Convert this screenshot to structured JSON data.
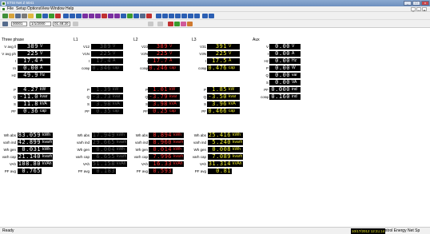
{
  "window": {
    "title": "ETSI Net Z 5041",
    "min": "_",
    "max": "□",
    "close": "x"
  },
  "menu": [
    "File",
    "Setup",
    "Options",
    "View",
    "Window",
    "Help"
  ],
  "mdi": {
    "min": "_",
    "restore": "▫",
    "close": "x"
  },
  "toolbar2": {
    "device": "00001",
    "date": "1/1/2000",
    "time": "01:48:20"
  },
  "sections": {
    "three": "Three phase",
    "l1": "L1",
    "l2": "L2",
    "l3": "L3",
    "aux": "Aux"
  },
  "three_phase": [
    {
      "label": "V avg ll",
      "value": "389",
      "unit": "V"
    },
    {
      "label": "V avg ph",
      "value": "225",
      "unit": "V"
    },
    {
      "label": "I",
      "value": "17.4",
      "unit": "A"
    },
    {
      "label": "In",
      "value": "0.00",
      "unit": "A"
    },
    {
      "label": "Hz",
      "value": "49.9",
      "unit": "Hz"
    },
    {
      "label": "P",
      "value": "4.27",
      "unit": "kW"
    },
    {
      "label": "Q",
      "value": "-11.0",
      "unit": "kvar"
    },
    {
      "label": "S",
      "value": "11.8",
      "unit": "kVA"
    },
    {
      "label": "PF",
      "value": "0.36",
      "unit": "cap"
    }
  ],
  "l1": [
    {
      "label": "V12",
      "value": "389",
      "unit": "V"
    },
    {
      "label": "V1N",
      "value": "225",
      "unit": "V"
    },
    {
      "label": "I",
      "value": "17.4",
      "unit": "A"
    },
    {
      "label": "cosφ",
      "value": "0.346",
      "unit": "cap"
    },
    {
      "label": "P",
      "value": "1.39",
      "unit": "kW"
    },
    {
      "label": "Q",
      "value": "-3.73",
      "unit": "kvar"
    },
    {
      "label": "S",
      "value": "3.98",
      "unit": "kVA"
    },
    {
      "label": "PF",
      "value": "0.35",
      "unit": "cap"
    }
  ],
  "l2": [
    {
      "label": "V23",
      "value": "389",
      "unit": "V"
    },
    {
      "label": "V2N",
      "value": "225",
      "unit": "V"
    },
    {
      "label": "I",
      "value": "17.7",
      "unit": "A"
    },
    {
      "label": "cosφ",
      "value": "0.246",
      "unit": "cap"
    },
    {
      "label": "P",
      "value": "1.01",
      "unit": "kW"
    },
    {
      "label": "Q",
      "value": "-3.79",
      "unit": "kvar"
    },
    {
      "label": "S",
      "value": "3.98",
      "unit": "kVA"
    },
    {
      "label": "PF",
      "value": "0.25",
      "unit": "cap"
    }
  ],
  "l3": [
    {
      "label": "V31",
      "value": "391",
      "unit": "V"
    },
    {
      "label": "V3N",
      "value": "225",
      "unit": "V"
    },
    {
      "label": "I",
      "value": "17.5",
      "unit": "A"
    },
    {
      "label": "cosφ",
      "value": "0.476",
      "unit": "cap"
    },
    {
      "label": "P",
      "value": "1.85",
      "unit": "kW"
    },
    {
      "label": "Q",
      "value": "-3.50",
      "unit": "kvar"
    },
    {
      "label": "S",
      "value": "3.96",
      "unit": "kVA"
    },
    {
      "label": "PF",
      "value": "0.466",
      "unit": "cap"
    }
  ],
  "aux": [
    {
      "label": "V",
      "value": "0.00",
      "unit": "V"
    },
    {
      "label": "I",
      "value": "0.00",
      "unit": "A"
    },
    {
      "label": "Hz",
      "value": "0.00",
      "unit": "Hz"
    },
    {
      "label": "P",
      "value": "0.00",
      "unit": "W"
    },
    {
      "label": "Q",
      "value": "0.00",
      "unit": "var"
    },
    {
      "label": "S",
      "value": "0.00",
      "unit": "VA"
    },
    {
      "label": "PF",
      "value": "0.000",
      "unit": "ind"
    },
    {
      "label": "cosφ",
      "value": "0.160",
      "unit": "ind"
    }
  ],
  "energy_three": [
    {
      "label": "Wh abs",
      "value": "83.059",
      "unit": "kWh"
    },
    {
      "label": "varh ind",
      "value": "42.899",
      "unit": "kvarh"
    },
    {
      "label": "Wh gen",
      "value": "0.031",
      "unit": "kWh"
    },
    {
      "label": "varh cap",
      "value": "21.140",
      "unit": "kvarh"
    },
    {
      "label": "VAh",
      "value": "108.80",
      "unit": "kVAh"
    },
    {
      "label": "PF avg",
      "value": "0.765",
      "unit": ""
    }
  ],
  "energy_l1": [
    {
      "label": "Wh abs",
      "value": "17.949",
      "unit": "kWh"
    },
    {
      "label": "varh ind",
      "value": "29.665",
      "unit": "kvarh"
    },
    {
      "label": "Wh gen",
      "value": "0.004",
      "unit": "kWh"
    },
    {
      "label": "varh cap",
      "value": "6.655",
      "unit": "kvarh"
    },
    {
      "label": "VAh",
      "value": "51.158",
      "unit": "kVAh"
    },
    {
      "label": "PF avg",
      "value": "0.183",
      "unit": ""
    }
  ],
  "energy_l2": [
    {
      "label": "Wh abs",
      "value": "8.894",
      "unit": "kWh"
    },
    {
      "label": "varh ind",
      "value": "8.960",
      "unit": "kvarh"
    },
    {
      "label": "Wh gen",
      "value": "0.014",
      "unit": "kWh"
    },
    {
      "label": "varh cap",
      "value": "7.996",
      "unit": "kvarh"
    },
    {
      "label": "VAh",
      "value": "16.33",
      "unit": "kVAh"
    },
    {
      "label": "PF avg",
      "value": "0.593",
      "unit": ""
    }
  ],
  "energy_l3": [
    {
      "label": "Wh abs",
      "value": "25.416",
      "unit": "kWh"
    },
    {
      "label": "varh ind",
      "value": "5.240",
      "unit": "kvarh"
    },
    {
      "label": "Wh gen",
      "value": "0.008",
      "unit": "kWh"
    },
    {
      "label": "varh cap",
      "value": "7.089",
      "unit": "kvarh"
    },
    {
      "label": "VAh",
      "value": "31.314",
      "unit": "kVAh"
    },
    {
      "label": "PF avg",
      "value": "0.81",
      "unit": ""
    }
  ],
  "status": {
    "left": "Ready",
    "clock": "10/17/2012 12:23:18",
    "company": "Econtrol Energy Net Sp"
  }
}
